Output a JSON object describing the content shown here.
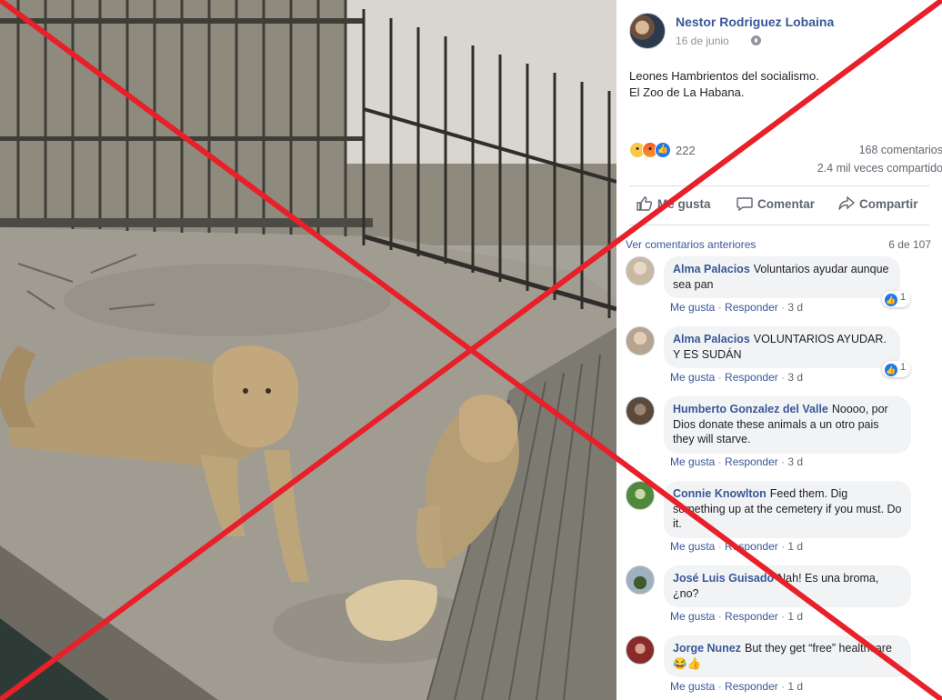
{
  "post": {
    "author": "Nestor Rodriguez Lobaina",
    "date": "16 de junio",
    "privacy_icon": "globe-icon",
    "text_line1": "Leones Hambrientos del socialismo.",
    "text_line2": "El Zoo de La Habana.",
    "reaction_count": "222",
    "comment_count": "168 comentarios",
    "share_count": "2.4 mil veces compartido"
  },
  "actions": {
    "like": "Me gusta",
    "comment": "Comentar",
    "share": "Compartir"
  },
  "comments_header": {
    "previous": "Ver comentarios anteriores",
    "count": "6 de 107"
  },
  "comment_meta": {
    "like": "Me gusta",
    "reply": "Responder",
    "separator": " · "
  },
  "comments": [
    {
      "name": "Alma Palacios",
      "text": "Voluntarios ayudar aunque sea pan",
      "age": "3 d",
      "likes": "1",
      "avatar_color": "#c9b8a4"
    },
    {
      "name": "Alma Palacios",
      "text": "VOLUNTARIOS AYUDAR. Y ES SUDÁN",
      "age": "3 d",
      "likes": "1",
      "avatar_color": "#b7a48f"
    },
    {
      "name": "Humberto Gonzalez del Valle",
      "text": "Noooo, por Dios donate these animals a un otro pais they will starve.",
      "age": "3 d",
      "likes": "",
      "avatar_color": "#5b4a3c"
    },
    {
      "name": "Connie Knowlton",
      "text": "Feed them. Dig something up at the cemetery if you must. Do it.",
      "age": "1 d",
      "likes": "",
      "avatar_color": "#4f8a3c"
    },
    {
      "name": "José Luis Guisado",
      "text": "Nah! Es una broma, ¿no?",
      "age": "1 d",
      "likes": "",
      "avatar_color": "#6f7f8f"
    },
    {
      "name": "Jorge Nunez",
      "text": "But they get “free” healthcare",
      "emoji": "😂👍",
      "age": "1 d",
      "likes": "",
      "avatar_color": "#8a2a2a"
    }
  ],
  "colors": {
    "link_blue": "#385898",
    "overlay_red": "#e8202a",
    "bubble_bg": "#f2f3f5"
  }
}
